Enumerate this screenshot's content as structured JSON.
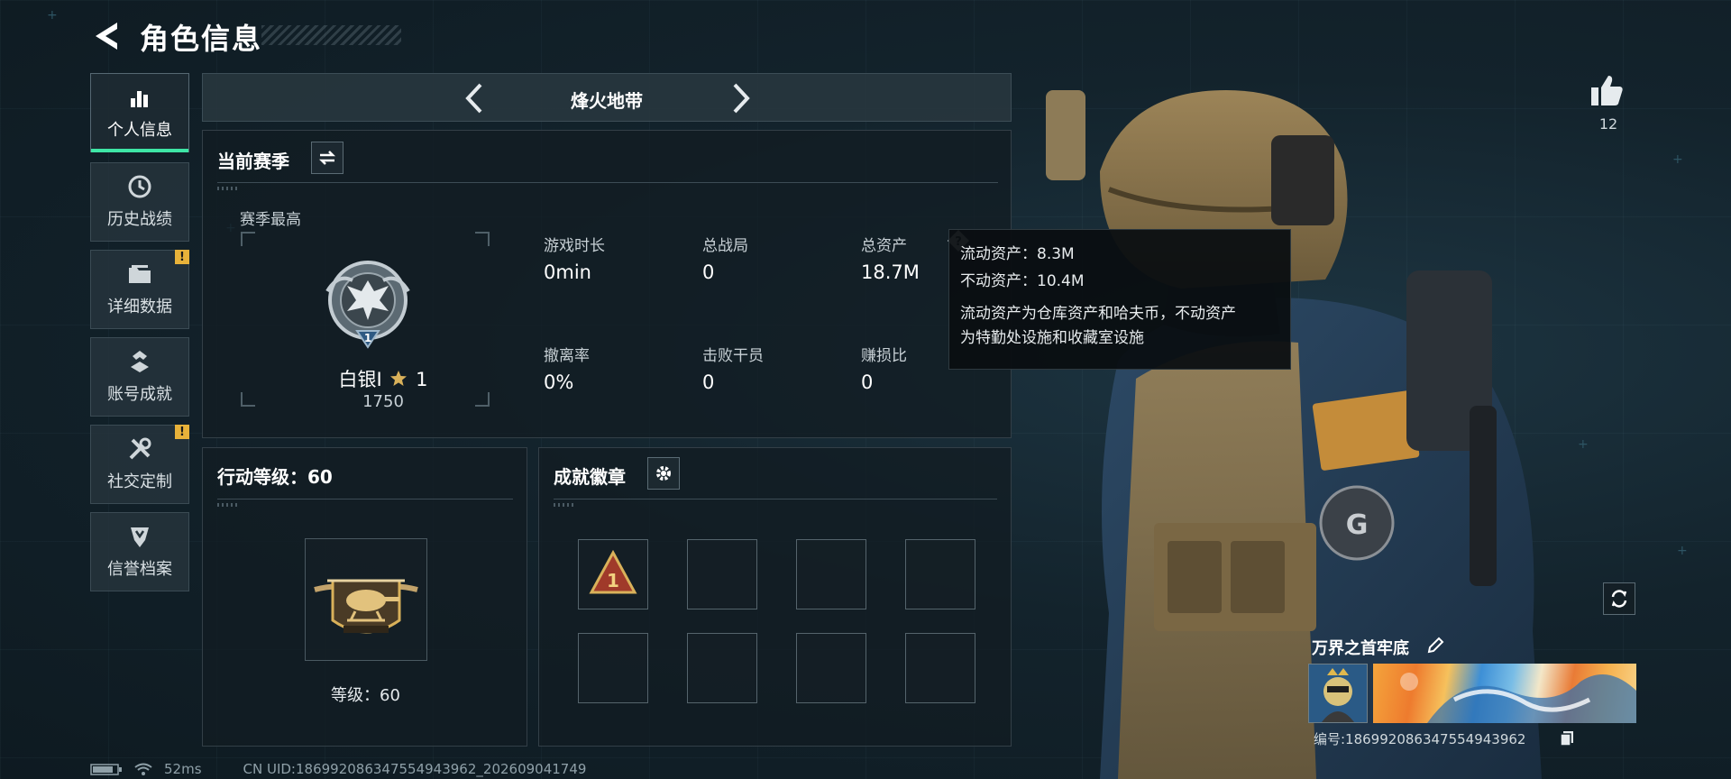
{
  "header": {
    "title": "角色信息"
  },
  "sidebar": {
    "items": [
      {
        "label": "个人信息",
        "icon": "bar-chart-icon",
        "active": true
      },
      {
        "label": "历史战绩",
        "icon": "clock-icon"
      },
      {
        "label": "详细数据",
        "icon": "folder-icon",
        "alert": "!"
      },
      {
        "label": "账号成就",
        "icon": "achievement-icon"
      },
      {
        "label": "社交定制",
        "icon": "tools-icon",
        "alert": "!"
      },
      {
        "label": "信誉档案",
        "icon": "shield-icon"
      }
    ]
  },
  "mode": {
    "title": "烽火地带"
  },
  "season": {
    "title": "当前赛季",
    "best_label": "赛季最高",
    "rank_name": "白银I",
    "rank_stars": "1",
    "rank_score": "1750",
    "rank_emblem_number": "1",
    "stats": [
      {
        "label": "游戏时长",
        "value": "0min"
      },
      {
        "label": "总战局",
        "value": "0"
      },
      {
        "label": "总资产",
        "value": "18.7M"
      },
      {
        "label": "撤离率",
        "value": "0%"
      },
      {
        "label": "击败干员",
        "value": "0"
      },
      {
        "label": "赚损比",
        "value": "0"
      }
    ]
  },
  "tooltip": {
    "liquid": "流动资产：8.3M",
    "fixed": "不动资产：10.4M",
    "note_line1": "流动资产为仓库资产和哈夫币，不动资产",
    "note_line2": "为特勤处设施和收藏室设施"
  },
  "action_level": {
    "title": "行动等级：60",
    "level_label": "等级：60"
  },
  "badges": {
    "title": "成就徽章",
    "slots": [
      {
        "filled": true,
        "number": "1"
      },
      {
        "filled": false
      },
      {
        "filled": false
      },
      {
        "filled": false
      },
      {
        "filled": false
      },
      {
        "filled": false
      },
      {
        "filled": false
      },
      {
        "filled": false
      }
    ]
  },
  "profile": {
    "likes": "12",
    "name": "万界之首牢底",
    "id_text": "编号:186992086347554943962"
  },
  "status": {
    "ping": "52ms",
    "uid": "CN UID:186992086347554943962_202609041749"
  },
  "colors": {
    "accent": "#3ee6a6",
    "alert": "#e8b23a",
    "gold": "#d9b15a"
  }
}
